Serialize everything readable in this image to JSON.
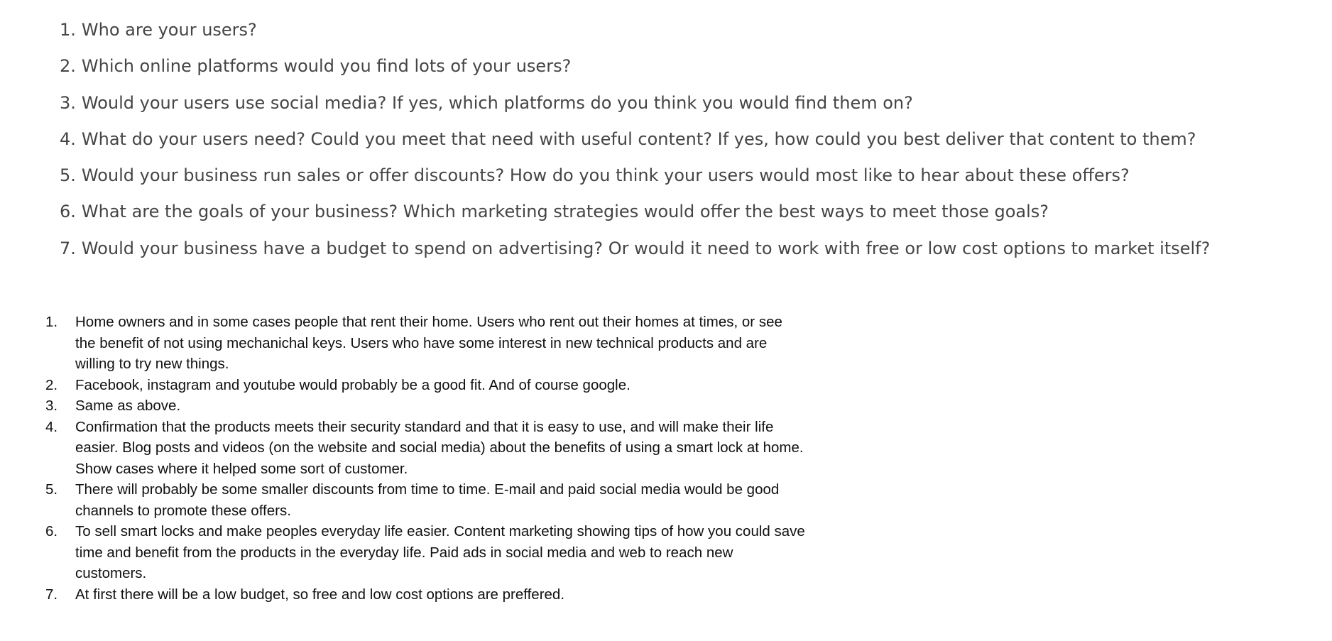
{
  "questions": [
    {
      "num": "1.",
      "text": "Who are your users?"
    },
    {
      "num": "2.",
      "text": "Which online platforms would you find lots of your users?"
    },
    {
      "num": "3.",
      "text": "Would your users use social media? If yes, which platforms do you think you would find them on?"
    },
    {
      "num": "4.",
      "text": "What do your users need? Could you meet that need with useful content? If yes, how could you best deliver that content to them?"
    },
    {
      "num": "5.",
      "text": "Would your business run sales or offer discounts? How do you think your users would most like to hear about these offers?"
    },
    {
      "num": "6.",
      "text": "What are the goals of your business? Which marketing strategies would offer the best ways to meet those goals?"
    },
    {
      "num": "7.",
      "text": "Would your business have a budget to spend on advertising? Or would it need to work with free or low cost options to market itself?"
    }
  ],
  "answers": [
    {
      "num": "1.",
      "text": "Home owners and in some cases people that rent their home. Users who rent out their homes at times, or see the benefit of not using mechanichal keys. Users who have some interest in new technical products and are willing to try new things."
    },
    {
      "num": "2.",
      "text": "Facebook, instagram and youtube would probably be a good fit. And of course google."
    },
    {
      "num": "3.",
      "text": "Same as above."
    },
    {
      "num": "4.",
      "text": "Confirmation that the products meets their security standard and that it is easy to use, and will make their life easier. Blog posts and videos (on the website and social media) about the benefits of using a smart lock at home. Show cases where it helped some sort of customer."
    },
    {
      "num": "5.",
      "text": "There will probably be some smaller discounts from time to time. E-mail and paid social media would be good channels to promote these offers."
    },
    {
      "num": "6.",
      "text": "To sell smart locks and make peoples everyday life easier. Content marketing showing tips of how you could save time and benefit from the products in the everyday life. Paid ads in social media and web to reach new customers."
    },
    {
      "num": "7.",
      "text": "At first there will be a low budget, so free and low cost options are preffered."
    }
  ]
}
